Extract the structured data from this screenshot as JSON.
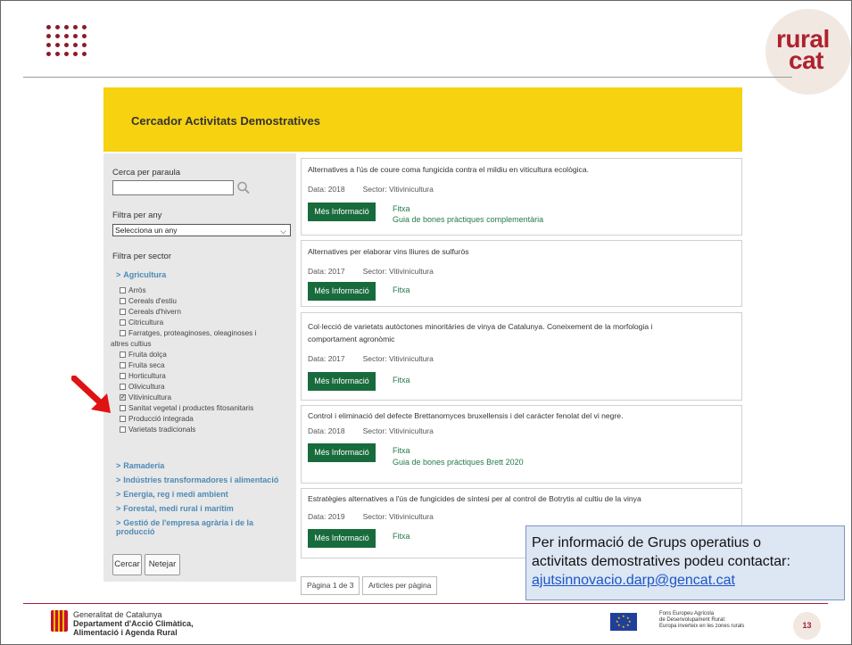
{
  "brand": {
    "line1": "rural",
    "line2": "cat",
    "accent": "#b0212e"
  },
  "banner": {
    "title": "Cercador Activitats Demostratives",
    "bg": "#f6d210"
  },
  "sidebar": {
    "search_label": "Cerca per paraula",
    "search_value": "",
    "year_label": "Filtra per any",
    "year_select": "Selecciona un any",
    "sector_label": "Filtra per sector",
    "sectors": {
      "agricultura": "Agricultura",
      "ramaderia": "Ramaderia",
      "industries": "Indústries transformadores i alimentació",
      "energia": "Energia, reg i medi ambient",
      "forestal": "Forestal, medi rural i marítim",
      "gestio_1": "Gestió de l'empresa agrària i de la",
      "gestio_2": "producció"
    },
    "checkboxes": [
      {
        "label": "Arròs",
        "checked": false
      },
      {
        "label": "Cereals d'estiu",
        "checked": false
      },
      {
        "label": "Cereals d'hivern",
        "checked": false
      },
      {
        "label": "Citricultura",
        "checked": false
      },
      {
        "label": "Farratges, proteaginoses, oleaginoses i",
        "label2": "altres cultius",
        "checked": false
      },
      {
        "label": "Fruita dolça",
        "checked": false
      },
      {
        "label": "Fruita seca",
        "checked": false
      },
      {
        "label": "Horticultura",
        "checked": false
      },
      {
        "label": "Olivicultura",
        "checked": false
      },
      {
        "label": "Vitivinicultura",
        "checked": true
      },
      {
        "label": "Sanitat vegetal i productes fitosanitaris",
        "checked": false
      },
      {
        "label": "Producció integrada",
        "checked": false
      },
      {
        "label": "Varietats tradicionals",
        "checked": false
      }
    ],
    "search_button": "Cercar",
    "clear_button": "Netejar"
  },
  "results": [
    {
      "title": "Alternatives a l'ús de coure coma fungicida contra el mildiu en viticultura ecològica.",
      "date_label": "Data:",
      "date": "2018",
      "sector_label": "Sector:",
      "sector": "Vitivinicultura",
      "button": "Més Informació",
      "links": [
        "Fitxa",
        "Guia de bones pràctiques complementària"
      ]
    },
    {
      "title": "Alternatives per elaborar vins lliures de sulfuròs",
      "date_label": "Data:",
      "date": "2017",
      "sector_label": "Sector:",
      "sector": "Vitivinicultura",
      "button": "Més Informació",
      "links": [
        "Fitxa"
      ]
    },
    {
      "title": "Col·lecció de varietats autòctones minoritàries de vinya de Catalunya. Coneixement de la morfologia i",
      "title2": "comportament agronòmic",
      "date_label": "Data:",
      "date": "2017",
      "sector_label": "Sector:",
      "sector": "Vitivinicultura",
      "button": "Més Informació",
      "links": [
        "Fitxa"
      ]
    },
    {
      "title": "Control i eliminació del defecte Brettanomyces bruxellensis i del caràcter fenolat del vi negre.",
      "date_label": "Data:",
      "date": "2018",
      "sector_label": "Sector:",
      "sector": "Vitivinicultura",
      "button": "Més Informació",
      "links": [
        "Fitxa",
        "Guia de bones pràctiques Brett 2020"
      ]
    },
    {
      "title": "Estratègies alternatives a l'ús de fungicides de síntesi per al control de Botrytis al cultiu de la vinya",
      "date_label": "Data:",
      "date": "2019",
      "sector_label": "Sector:",
      "sector": "Vitivinicultura",
      "button": "Més Informació",
      "links": [
        "Fitxa"
      ]
    }
  ],
  "pager": {
    "page": "Pàgina 1 de 3",
    "per_page": "Articles per pàgina"
  },
  "contact": {
    "line1": "Per informació de Grups operatius o",
    "line2": "activitats demostratives podeu contactar:",
    "email": "ajutsinnovacio.darp@gencat.cat"
  },
  "footer": {
    "gencat_1": "Generalitat de Catalunya",
    "gencat_2": "Departament d'Acció Climàtica,",
    "gencat_3": "Alimentació i Agenda Rural",
    "eu_1": "Fons Europeu Agrícola",
    "eu_2": "de Desenvolupament Rural:",
    "eu_3": "Europa inverteix en les zones rurals",
    "page_number": "13"
  }
}
